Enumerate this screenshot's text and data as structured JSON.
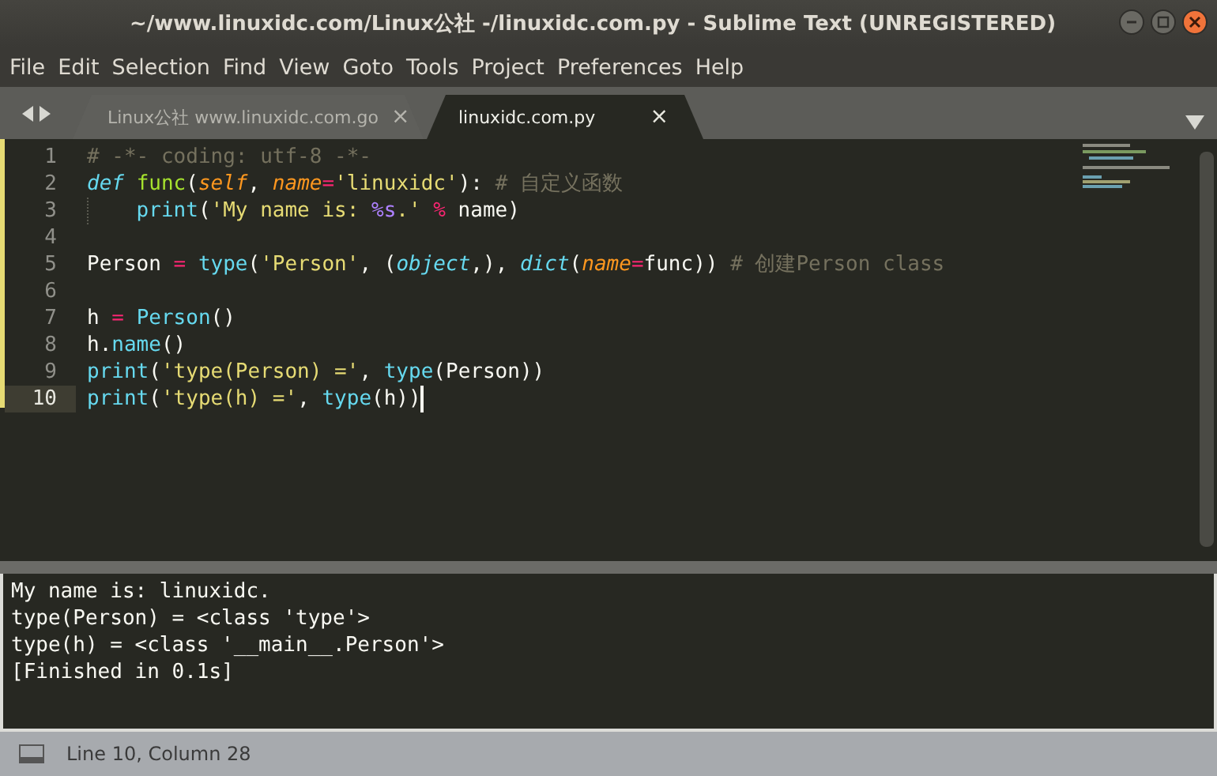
{
  "window": {
    "title": "~/www.linuxidc.com/Linux公社 -/linuxidc.com.py - Sublime Text (UNREGISTERED)"
  },
  "menu": [
    "File",
    "Edit",
    "Selection",
    "Find",
    "View",
    "Goto",
    "Tools",
    "Project",
    "Preferences",
    "Help"
  ],
  "tabs": [
    {
      "label": "Linux公社 www.linuxidc.com.go",
      "selected": false,
      "close": "×"
    },
    {
      "label": "linuxidc.com.py",
      "selected": true,
      "close": "×"
    }
  ],
  "editor": {
    "lines": [
      {
        "number": "1",
        "current": false,
        "tokens": [
          {
            "kind": "comment",
            "text": "# -*- coding: utf-8 -*-"
          }
        ]
      },
      {
        "number": "2",
        "current": false,
        "tokens": [
          {
            "kind": "keyword",
            "text": "def "
          },
          {
            "kind": "func",
            "text": "func"
          },
          {
            "kind": "plain",
            "text": "("
          },
          {
            "kind": "param",
            "text": "self"
          },
          {
            "kind": "plain",
            "text": ", "
          },
          {
            "kind": "param",
            "text": "name"
          },
          {
            "kind": "op",
            "text": "="
          },
          {
            "kind": "string",
            "text": "'linuxidc'"
          },
          {
            "kind": "plain",
            "text": "): "
          },
          {
            "kind": "comment",
            "text": "# 自定义函数"
          }
        ]
      },
      {
        "number": "3",
        "current": false,
        "indented": true,
        "tokens": [
          {
            "kind": "builtin",
            "text": "print"
          },
          {
            "kind": "plain",
            "text": "("
          },
          {
            "kind": "string",
            "text": "'My name is: "
          },
          {
            "kind": "format",
            "text": "%s"
          },
          {
            "kind": "string",
            "text": ".' "
          },
          {
            "kind": "op",
            "text": "%"
          },
          {
            "kind": "plain",
            "text": " name)"
          }
        ]
      },
      {
        "number": "4",
        "current": false
      },
      {
        "number": "5",
        "current": false,
        "tokens": [
          {
            "kind": "plain",
            "text": "Person "
          },
          {
            "kind": "op",
            "text": "= "
          },
          {
            "kind": "builtin",
            "text": "type"
          },
          {
            "kind": "plain",
            "text": "("
          },
          {
            "kind": "string",
            "text": "'Person'"
          },
          {
            "kind": "plain",
            "text": ", ("
          },
          {
            "kind": "typename",
            "text": "object"
          },
          {
            "kind": "plain",
            "text": ",), "
          },
          {
            "kind": "typename",
            "text": "dict"
          },
          {
            "kind": "plain",
            "text": "("
          },
          {
            "kind": "param",
            "text": "name"
          },
          {
            "kind": "op",
            "text": "="
          },
          {
            "kind": "plain",
            "text": "func)) "
          },
          {
            "kind": "comment",
            "text": "# 创建Person class"
          }
        ]
      },
      {
        "number": "6",
        "current": false
      },
      {
        "number": "7",
        "current": false,
        "tokens": [
          {
            "kind": "plain",
            "text": "h "
          },
          {
            "kind": "op",
            "text": "= "
          },
          {
            "kind": "builtin",
            "text": "Person"
          },
          {
            "kind": "plain",
            "text": "()"
          }
        ]
      },
      {
        "number": "8",
        "current": false,
        "tokens": [
          {
            "kind": "plain",
            "text": "h."
          },
          {
            "kind": "builtin",
            "text": "name"
          },
          {
            "kind": "plain",
            "text": "()"
          }
        ]
      },
      {
        "number": "9",
        "current": false,
        "tokens": [
          {
            "kind": "builtin",
            "text": "print"
          },
          {
            "kind": "plain",
            "text": "("
          },
          {
            "kind": "string",
            "text": "'type(Person) ='"
          },
          {
            "kind": "plain",
            "text": ", "
          },
          {
            "kind": "builtin",
            "text": "type"
          },
          {
            "kind": "plain",
            "text": "(Person))"
          }
        ]
      },
      {
        "number": "10",
        "current": true,
        "tokens": [
          {
            "kind": "builtin",
            "text": "print"
          },
          {
            "kind": "plain",
            "text": "("
          },
          {
            "kind": "string",
            "text": "'type(h) ='"
          },
          {
            "kind": "plain",
            "text": ", "
          },
          {
            "kind": "builtin",
            "text": "type"
          },
          {
            "kind": "plain",
            "text": "(h))"
          }
        ]
      }
    ]
  },
  "output": [
    "My name is: linuxidc.",
    "type(Person) = <class 'type'>",
    "type(h) = <class '__main__.Person'>",
    "[Finished in 0.1s]"
  ],
  "status_bar": {
    "position": "Line 10, Column 28"
  }
}
